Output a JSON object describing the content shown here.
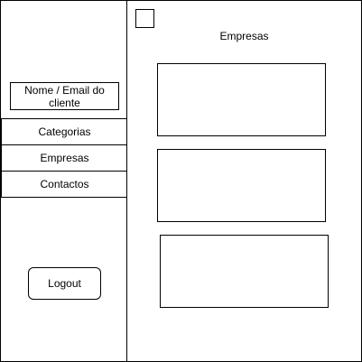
{
  "sidebar": {
    "client_label": "Nome / Email do cliente",
    "items": [
      {
        "label": "Categorias"
      },
      {
        "label": "Empresas"
      },
      {
        "label": "Contactos"
      }
    ],
    "logout_label": "Logout"
  },
  "main": {
    "title": "Empresas"
  },
  "colors": {
    "stroke": "#000000",
    "background": "#ffffff"
  }
}
